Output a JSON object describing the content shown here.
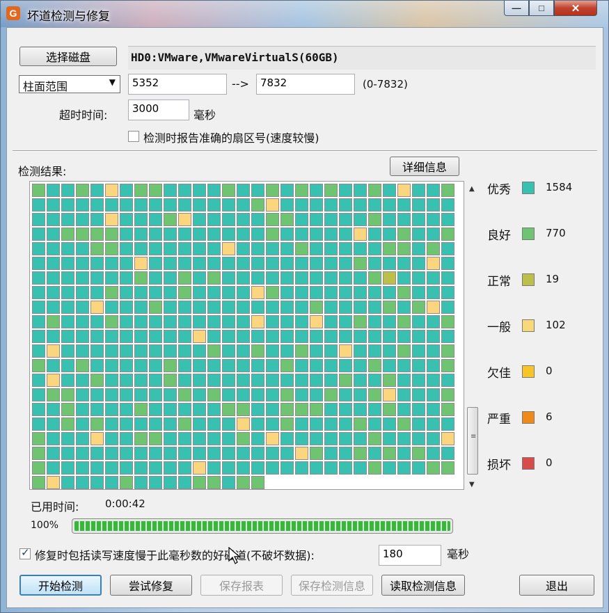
{
  "window": {
    "title": "坏道检测与修复",
    "app_icon": "G",
    "min_glyph": "—",
    "max_glyph": "□",
    "close_glyph": "✕"
  },
  "disk": {
    "select_label": "选择磁盘",
    "name": "HD0:VMware,VMwareVirtualS(60GB)"
  },
  "range": {
    "mode": "柱面范围",
    "start": "5352",
    "arrow": "-->",
    "end": "7832",
    "hint": "(0-7832)"
  },
  "timeout": {
    "label": "超时时间:",
    "value": "3000",
    "unit": "毫秒"
  },
  "report_sector": {
    "label": "检测时报告准确的扇区号(速度较慢)",
    "checked": false
  },
  "results": {
    "label": "检测结果:",
    "details_label": "详细信息"
  },
  "legend": [
    {
      "label": "优秀",
      "color": "#38c0b0",
      "count": "1584"
    },
    {
      "label": "良好",
      "color": "#6fc471",
      "count": "770"
    },
    {
      "label": "正常",
      "color": "#bcc04a",
      "count": "19"
    },
    {
      "label": "一般",
      "color": "#f8d97a",
      "count": "102"
    },
    {
      "label": "欠佳",
      "color": "#f7c42a",
      "count": "0"
    },
    {
      "label": "严重",
      "color": "#ee8a1c",
      "count": "6"
    },
    {
      "label": "损坏",
      "color": "#d94a4a",
      "count": "0"
    }
  ],
  "elapsed": {
    "label": "已用时间:",
    "value": "0:00:42"
  },
  "progress": {
    "percent_label": "100%",
    "fraction": 1.0
  },
  "repair_option": {
    "checked": true,
    "label": "修复时包括读写速度慢于此毫秒数的好磁道(不破坏数据):",
    "value": "180",
    "unit": "毫秒"
  },
  "buttons": {
    "start": "开始检测",
    "try_repair": "尝试修复",
    "save_report": "保存报表",
    "save_info": "保存检测信息",
    "load_info": "读取检测信息",
    "exit": "退出"
  },
  "grid": {
    "cols": 29,
    "rows": 21,
    "last_row_count": 16,
    "palette": {
      "t": "#38c0b0",
      "g": "#6fc471",
      "y": "#fcd67e",
      "o": "#bcc04a"
    },
    "rows_data": [
      "gttgtytggttttgttgtgtgttgtyttg",
      "tttttttttttttttgytttttttttttt",
      "tttttytttgytttttggtttttgttttt",
      "ttggggttttttttttgtttttyttgttg",
      "ttttggtttttttyttttgtttttggtgt",
      "tttttttyttttttttttttttgttttyt",
      "tttttttgttgtgttttttttttgotttt",
      "tttttgttttgttttygttttttttgttt",
      "ttttytttgttttttttttgttttgtgyt",
      "tgtttgtttttttttytttyttgttgttg",
      "tttttttttttyttttttttttttttttt",
      "tyttttttttttgttgttgttytttgttg",
      "gttgtttttgtttttttgtttttgttttg",
      "tyttgttttgtttttttttttgttgtttt",
      "tggtttttttgtgttttgttgttgytttg",
      "ttgttttgtttttggttgggttttgtttg",
      "ttgtgtttttgtttyttgttttgttgttt",
      "gtttyttggtttttgtyttttttgtttty",
      "gtttttttttttttttttygttgtgtgtt",
      "gttttttttttytttttttttttgtttgg",
      "gyttttgttttggtgg"
    ]
  }
}
